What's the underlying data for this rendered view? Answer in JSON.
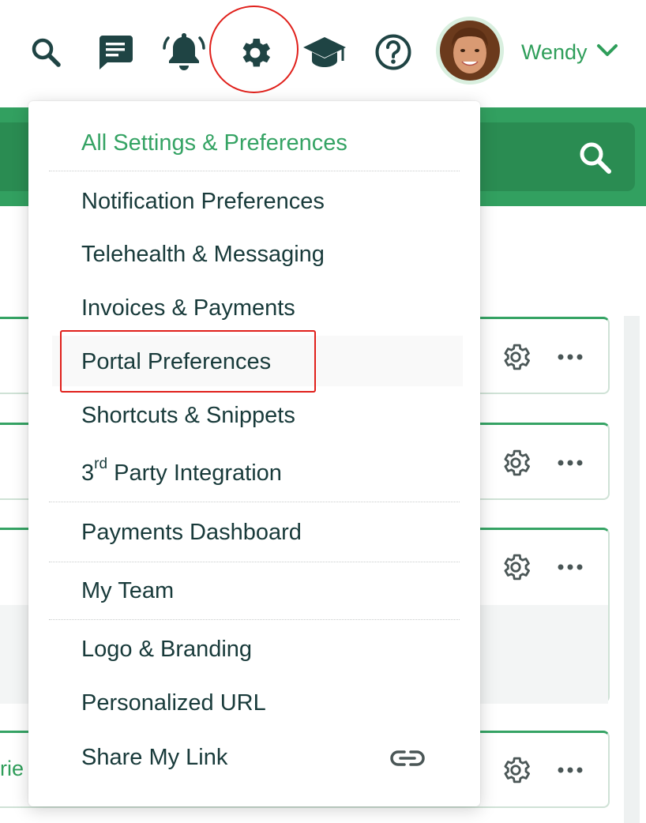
{
  "header": {
    "user_name": "Wendy",
    "icons": [
      "search-icon",
      "chat-icon",
      "bell-icon",
      "gear-icon",
      "graduation-cap-icon",
      "help-icon",
      "chevron-down-icon"
    ]
  },
  "settings_menu": {
    "header": "All Settings & Preferences",
    "items": [
      {
        "label": "Notification Preferences"
      },
      {
        "label": "Telehealth & Messaging"
      },
      {
        "label": "Invoices & Payments"
      },
      {
        "label": "Portal Preferences",
        "highlighted": true
      },
      {
        "label": "Shortcuts & Snippets"
      },
      {
        "label_prefix": "3",
        "label_sup": "rd",
        "label": "Party Integration"
      },
      {
        "label": "Payments Dashboard"
      },
      {
        "label": "My Team"
      },
      {
        "label": "Logo & Branding"
      },
      {
        "label": "Personalized URL"
      },
      {
        "label": "Share My Link",
        "icon": "link-icon"
      }
    ]
  },
  "background": {
    "partial_text": "rie"
  },
  "colors": {
    "brand_green": "#32a060",
    "text_green": "#2f9e5a",
    "annotation_red": "#e0201b",
    "text_dark": "#183a3a"
  }
}
